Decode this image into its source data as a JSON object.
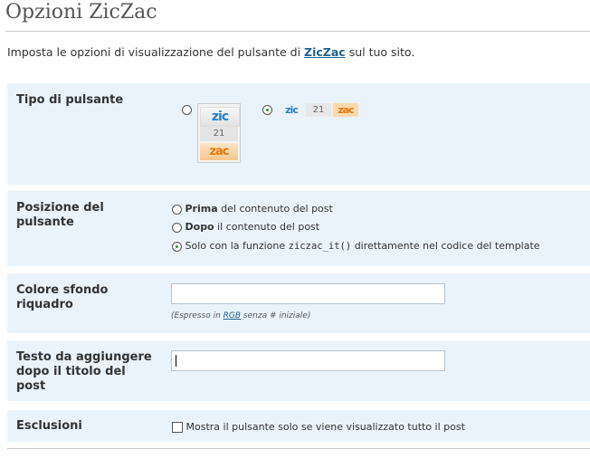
{
  "page": {
    "title": "Opzioni ZicZac"
  },
  "intro": {
    "before": "Imposta le opzioni di visualizzazione del pulsante di ",
    "link": "ZicZac",
    "after": " sul tuo sito."
  },
  "sections": {
    "tipo": {
      "label": "Tipo di pulsante",
      "tall": {
        "zic": "zic",
        "count": "21",
        "zac": "zac"
      },
      "wide": {
        "zic": "zic",
        "count": "21",
        "zac": "zac"
      }
    },
    "posizione": {
      "label": "Posizione del pulsante",
      "opt1_bold": "Prima",
      "opt1_rest": " del contenuto del post",
      "opt2_bold": "Dopo",
      "opt2_rest": " il contenuto del post",
      "opt3_before": "Solo con la funzione ",
      "opt3_code": "ziczac_it()",
      "opt3_after": " direttamente nel codice del template"
    },
    "colore": {
      "label": "Colore sfondo riquadro",
      "value": "",
      "hint_before": "(Espresso in ",
      "hint_link": "RGB",
      "hint_after": " senza # iniziale)"
    },
    "testo": {
      "label": "Testo da aggiungere dopo il titolo del post",
      "value": ""
    },
    "esclusioni": {
      "label": "Esclusioni",
      "checkbox_label": "Mostra il pulsante solo se viene visualizzato tutto il post"
    }
  },
  "colors": {
    "section_bg": "#eaf3fa",
    "link": "#1e5f8f",
    "zic_blue": "#2a7fc1",
    "zac_orange": "#e07a12"
  }
}
